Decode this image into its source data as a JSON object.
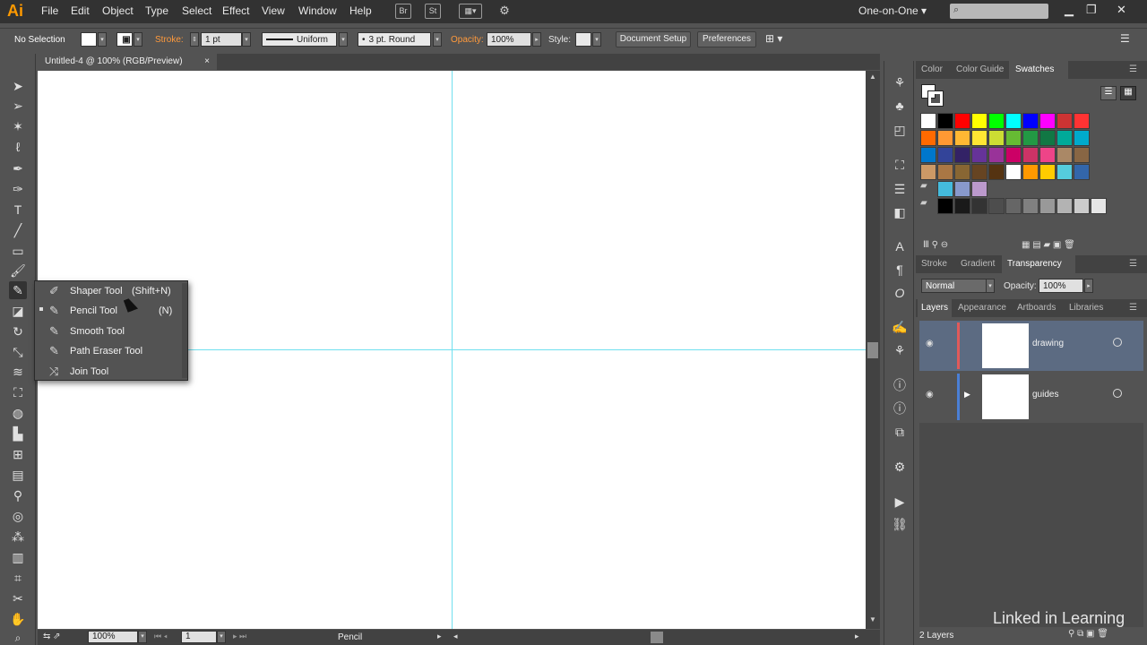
{
  "app": {
    "logo": "Ai",
    "workspace": "One-on-One ▾"
  },
  "menu": [
    "File",
    "Edit",
    "Object",
    "Type",
    "Select",
    "Effect",
    "View",
    "Window",
    "Help"
  ],
  "menubar_buttons": {
    "br": "Br",
    "st": "St"
  },
  "control": {
    "selection": "No Selection",
    "stroke_label": "Stroke:",
    "stroke_weight": "1 pt",
    "stroke_profile": "Uniform",
    "brush": "3 pt. Round",
    "opacity_label": "Opacity:",
    "opacity_value": "100%",
    "style_label": "Style:",
    "doc_setup": "Document Setup",
    "preferences": "Preferences"
  },
  "tab": {
    "title": "Untitled-4 @ 100% (RGB/Preview)",
    "close": "×"
  },
  "flyout": {
    "items": [
      {
        "label": "Shaper Tool",
        "shortcut": "(Shift+N)"
      },
      {
        "label": "Pencil Tool",
        "shortcut": "(N)"
      },
      {
        "label": "Smooth Tool",
        "shortcut": ""
      },
      {
        "label": "Path Eraser Tool",
        "shortcut": ""
      },
      {
        "label": "Join Tool",
        "shortcut": ""
      }
    ]
  },
  "panels": {
    "color_tabs": [
      "Color",
      "Color Guide",
      "Swatches"
    ],
    "trans_tabs": [
      "Stroke",
      "Gradient",
      "Transparency"
    ],
    "blend_mode": "Normal",
    "opacity_label": "Opacity:",
    "opacity_value": "100%",
    "layer_tabs": [
      "Layers",
      "Appearance",
      "Artboards",
      "Libraries"
    ],
    "layers": [
      {
        "name": "drawing",
        "color": "#e05a5a"
      },
      {
        "name": "guides",
        "color": "#4a7fd6"
      }
    ],
    "layers_count": "2 Layers"
  },
  "bottom": {
    "zoom": "100%",
    "page": "1",
    "tool_status": "Pencil"
  },
  "brand": "Linked in Learning",
  "swatch_colors": [
    [
      "#ffffff",
      "#000000",
      "#ff0000",
      "#ffff00",
      "#00ff00",
      "#00ffff",
      "#0000ff",
      "#ff00ff",
      "#cc3333",
      "#ff3333"
    ],
    [
      "#ff6a00",
      "#ff9933",
      "#ffb833",
      "#ffe633",
      "#ccdd33",
      "#66bb33",
      "#229944",
      "#117744",
      "#00aa99",
      "#00aacc"
    ],
    [
      "#0077cc",
      "#334499",
      "#332266",
      "#663399",
      "#993399",
      "#cc0066",
      "#cc3366",
      "#ee4488",
      "#aa8866",
      "#886644"
    ],
    [
      "#cc9966",
      "#aa7744",
      "#886633",
      "#664422",
      "#553311",
      "#ffffff",
      "#ff9900",
      "#ffcc00",
      "#55ccdd",
      "#3366aa"
    ],
    [
      "#44bbdd",
      "#8899cc",
      "#bb99cc"
    ],
    [
      "#000000",
      "#1a1a1a",
      "#333333",
      "#4d4d4d",
      "#666666",
      "#808080",
      "#999999",
      "#b3b3b3",
      "#cccccc",
      "#e6e6e6"
    ]
  ]
}
